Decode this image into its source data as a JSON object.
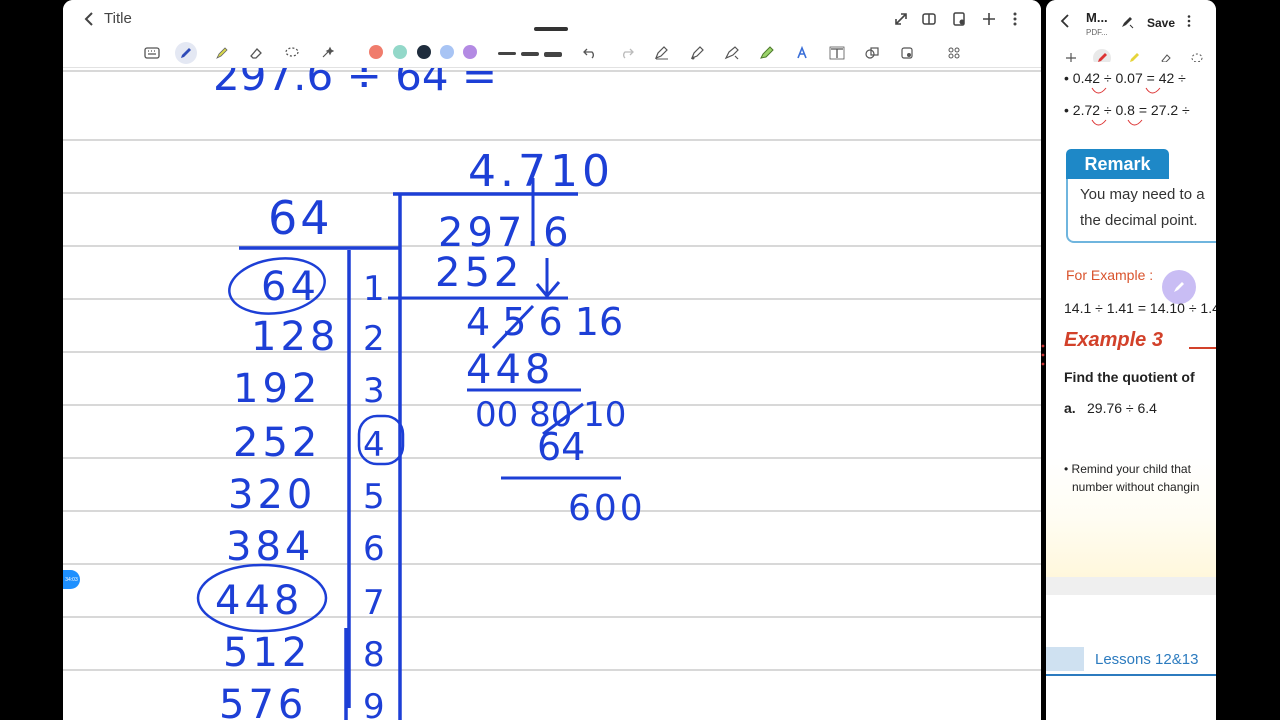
{
  "notes": {
    "title": "Title",
    "toolbar_colors": [
      "#f07c6c",
      "#93d8c9",
      "#1f2d3d",
      "#a8c4f4",
      "#b38ae3"
    ],
    "ink_color": "#1d3fd6",
    "handwriting": {
      "equation": "297.6  ÷  64  =",
      "quotient": "4.710",
      "divisor": "64",
      "dividend": "297.6",
      "step1": "252",
      "step2": "4 5 6 16",
      "step3": "448",
      "step4": "00 80 10",
      "step5": "64",
      "remainder": "600",
      "multiples": [
        "64",
        "128",
        "192",
        "252",
        "320",
        "384",
        "448",
        "512",
        "576"
      ],
      "multipliers": [
        "1",
        "2",
        "3",
        "4",
        "5",
        "6",
        "7",
        "8",
        "9"
      ]
    },
    "timer_label": "34:03"
  },
  "side_panel": {
    "title": "M...",
    "subtitle": "PDF...",
    "save_label": "Save",
    "lines": {
      "ex1": "• 0.42 ÷ 0.07 = 42 ÷",
      "ex2": "• 2.72 ÷ 0.8 = 27.2 ÷",
      "remark_tag": "Remark",
      "remark_line1": "You may need to a",
      "remark_line2": "the decimal point.",
      "for_example": "For Example :",
      "example_eq": "14.1 ÷ 1.41 = 14.10 ÷ 1.4",
      "example_heading": "Example 3",
      "find_quotient": "Find the quotient of",
      "part_a_label": "a.",
      "part_a": "29.76 ÷ 6.4",
      "remind1": "• Remind your child that",
      "remind2": "number without changin",
      "lessons": "Lessons 12&13"
    }
  }
}
